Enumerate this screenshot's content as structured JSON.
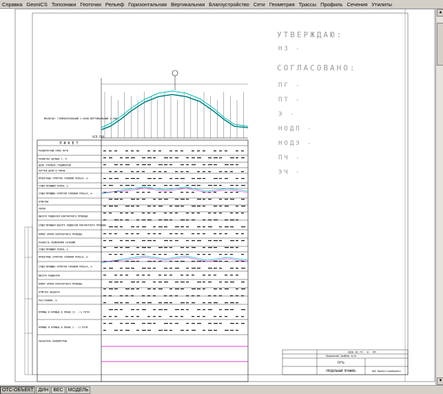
{
  "menu": {
    "items": [
      "Справка",
      "GeoniCS",
      "Топознаки",
      "Геоточки",
      "Рельеф",
      "Горизонтальная",
      "Вертикальная",
      "Благоустройство",
      "Сети",
      "Геометрия",
      "Трассы",
      "Профиль",
      "Сечения",
      "Утилиты"
    ]
  },
  "status_bar": {
    "items": [
      "ОТС-ОБЪЕКТ",
      "ДИН",
      "ВЕС",
      "МОДЕЛЬ"
    ]
  },
  "drawing": {
    "approval": {
      "title1": "УТВЕРЖДАЮ:",
      "line_nz": "НЗ -",
      "title2": "СОГЛАСОВАНО:",
      "signers": [
        "ПГ -",
        "ПТ -",
        "Э -",
        "НОДП -",
        "НОДЭ -",
        "ПЧ -",
        "ЭЧ -"
      ]
    },
    "profile_table": {
      "header": "П И К Е Т",
      "rows": [
        "РАЗВЕРНУТЫЙ ПЛАН ПУТИ",
        "РАЗМЕТКА ЦЕПНЫХ Г. Р.",
        "ЦЕНА ЭТАЛОНА ГРАДИЕНТОВ",
        "ЧЕРТЕЖ ЦЕПИ В ПЛАНЕ",
        "ПРОЕКТНЫЕ ОТМЕТКИ ГОЛОВКИ РЕЛЬСА, м",
        "СУЩЕСТВУЮЩИЙ УКЛОН, ‰",
        "СУЩЕСТВУЮЩИЕ ОТМЕТКИ ГОЛОВКИ РЕЛЬСА, м",
        "ОТМЕТКИ",
        "УКЛОН",
        "ВЫСОТА ПОДВЕСКИ КОНТАКТНОГО ПРОВОДА",
        "СУЩЕСТВУЮЩАЯ ВЫСОТА ПОДВЕСКИ КОНТАКТНОГО ПРОВОДА",
        "НОМЕР ОПОРЫ КОНТАКТНОГО ПРОВОДА",
        "РАЗНОСТЬ ПОЯВЛЕНИЯ СЕЧЕНИЙ",
        "СУЩЕСТВУЮЩИЙ УКЛОН, ‰",
        "ПРОЕКТНЫЕ ОТМЕТКИ ГОЛОВКИ РЕЛЬСА, м",
        "СУЩЕСТВУЮЩИЕ ОТМЕТКИ ГОЛОВКИ РЕЛЬСА, м",
        "ВЫСОТА ПОДВЕСКИ",
        "НОМЕР ОПОРЫ КОНТАКТНОГО ПРОВОДА",
        "ОТМЕТКА ОБЪЕКТА",
        "РАССТОЯНИЕ, м",
        "ПРЯМЫЕ И КРИВЫЕ В ПЛАНЕ II - го ПУТИ",
        "ПРЯМЫЕ И КРИВЫЕ В ПЛАНЕ I - го ПУТИ",
        "УКАЗАТЕЛЬ КИЛОМЕТРОВ"
      ],
      "left_label": "МАСШТАБ: ГОРИЗОНТАЛЬНЫЙ 1:2000  ВЕРТИКАЛЬНЫЙ 1:200",
      "datum_label": "УСЛ.ГОР.",
      "scale_label": "ПРОДОЛЬНЫЙ ПРОФИЛЬ ПУТИ"
    },
    "stamp": {
      "code": "2020-16.74 - 0 - ПП",
      "description": "Продольный профиль пути",
      "subtitle": "ПУТЬ",
      "sheet_label": "ПРОДОЛЬНЫЙ ПРОФИЛЬ",
      "org": "ОАО Проектстройпроект"
    },
    "colors": {
      "profile_cyan": "#00b8b8",
      "profile_magenta": "#cc00cc",
      "profile_teal": "#008080",
      "ink": "#000000",
      "approval_gray": "#9a9a9a"
    }
  }
}
